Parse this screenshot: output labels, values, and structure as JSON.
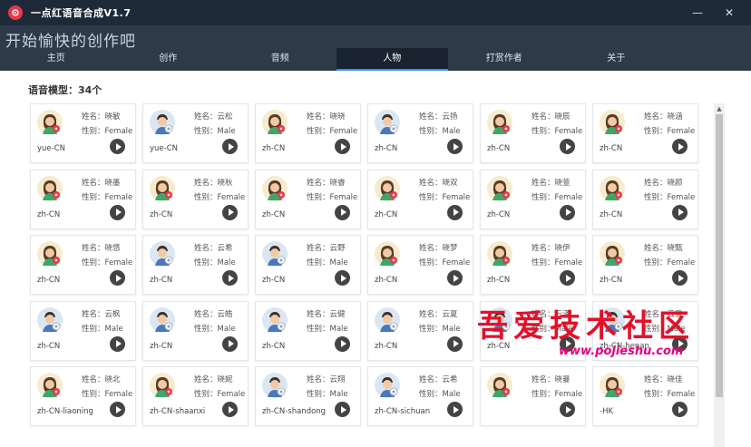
{
  "window": {
    "title": "一点红语音合成V1.7",
    "minimize": "—",
    "close": "✕"
  },
  "header": {
    "slogan": "开始愉快的创作吧"
  },
  "tabs": [
    {
      "label": "主页",
      "active": false
    },
    {
      "label": "创作",
      "active": false
    },
    {
      "label": "音频",
      "active": false
    },
    {
      "label": "人物",
      "active": true
    },
    {
      "label": "打赏作者",
      "active": false
    },
    {
      "label": "关于",
      "active": false
    }
  ],
  "model_count_label": "语音模型：34个",
  "labels": {
    "name_prefix": "姓名：",
    "gender_prefix": "性别："
  },
  "voices": [
    {
      "name": "晓敏",
      "gender": "Female",
      "locale": "yue-CN",
      "avatar": "female-avatar-icon"
    },
    {
      "name": "云松",
      "gender": "Male",
      "locale": "yue-CN",
      "avatar": "male-avatar-icon"
    },
    {
      "name": "晓晓",
      "gender": "Female",
      "locale": "zh-CN",
      "avatar": "female-avatar-icon"
    },
    {
      "name": "云扬",
      "gender": "Male",
      "locale": "zh-CN",
      "avatar": "male-avatar-icon"
    },
    {
      "name": "晓辰",
      "gender": "Female",
      "locale": "zh-CN",
      "avatar": "female-avatar-icon"
    },
    {
      "name": "晓涵",
      "gender": "Female",
      "locale": "zh-CN",
      "avatar": "female-avatar-icon"
    },
    {
      "name": "晓墨",
      "gender": "Female",
      "locale": "zh-CN",
      "avatar": "female-avatar-icon"
    },
    {
      "name": "晓秋",
      "gender": "Female",
      "locale": "zh-CN",
      "avatar": "female-avatar-icon"
    },
    {
      "name": "晓睿",
      "gender": "Female",
      "locale": "zh-CN",
      "avatar": "female-avatar-icon"
    },
    {
      "name": "晓双",
      "gender": "Female",
      "locale": "zh-CN",
      "avatar": "female-avatar-icon"
    },
    {
      "name": "晓萱",
      "gender": "Female",
      "locale": "zh-CN",
      "avatar": "female-avatar-icon"
    },
    {
      "name": "晓颜",
      "gender": "Female",
      "locale": "zh-CN",
      "avatar": "female-avatar-icon"
    },
    {
      "name": "晓悠",
      "gender": "Female",
      "locale": "zh-CN",
      "avatar": "female-avatar-icon"
    },
    {
      "name": "云希",
      "gender": "Male",
      "locale": "zh-CN",
      "avatar": "male-avatar-icon"
    },
    {
      "name": "云野",
      "gender": "Male",
      "locale": "zh-CN",
      "avatar": "male-avatar-icon"
    },
    {
      "name": "晓梦",
      "gender": "Female",
      "locale": "zh-CN",
      "avatar": "female-avatar-icon"
    },
    {
      "name": "晓伊",
      "gender": "Female",
      "locale": "zh-CN",
      "avatar": "female-avatar-icon"
    },
    {
      "name": "晓甄",
      "gender": "Female",
      "locale": "zh-CN",
      "avatar": "female-avatar-icon"
    },
    {
      "name": "云枫",
      "gender": "Male",
      "locale": "zh-CN",
      "avatar": "male-avatar-icon"
    },
    {
      "name": "云皓",
      "gender": "Male",
      "locale": "zh-CN",
      "avatar": "male-avatar-icon"
    },
    {
      "name": "云健",
      "gender": "Male",
      "locale": "zh-CN",
      "avatar": "male-avatar-icon"
    },
    {
      "name": "云夏",
      "gender": "Male",
      "locale": "zh-CN",
      "avatar": "male-avatar-icon"
    },
    {
      "name": "云泽",
      "gender": "Male",
      "locale": "zh-CN",
      "avatar": "male-avatar-icon"
    },
    {
      "name": "云登",
      "gender": "Male",
      "locale": "zh-CN-henan",
      "avatar": "male-avatar-icon"
    },
    {
      "name": "晓北",
      "gender": "Female",
      "locale": "zh-CN-liaoning",
      "avatar": "female-avatar-icon"
    },
    {
      "name": "晓妮",
      "gender": "Female",
      "locale": "zh-CN-shaanxi",
      "avatar": "female-avatar-icon"
    },
    {
      "name": "云翔",
      "gender": "Male",
      "locale": "zh-CN-shandong",
      "avatar": "male-avatar-icon"
    },
    {
      "name": "云希",
      "gender": "Male",
      "locale": "zh-CN-sichuan",
      "avatar": "male-avatar-icon"
    },
    {
      "name": "晓曼",
      "gender": "Female",
      "locale": "",
      "avatar": "female-avatar-icon"
    },
    {
      "name": "晓佳",
      "gender": "Female",
      "locale": "-HK",
      "avatar": "female-avatar-icon"
    }
  ],
  "watermark": {
    "text": "吾爱技术社区",
    "url": "www.pojieshu.com"
  },
  "colors": {
    "accent": "#3b8fe0",
    "logo": "#e8374a",
    "header_bg": "#2e3a48"
  }
}
